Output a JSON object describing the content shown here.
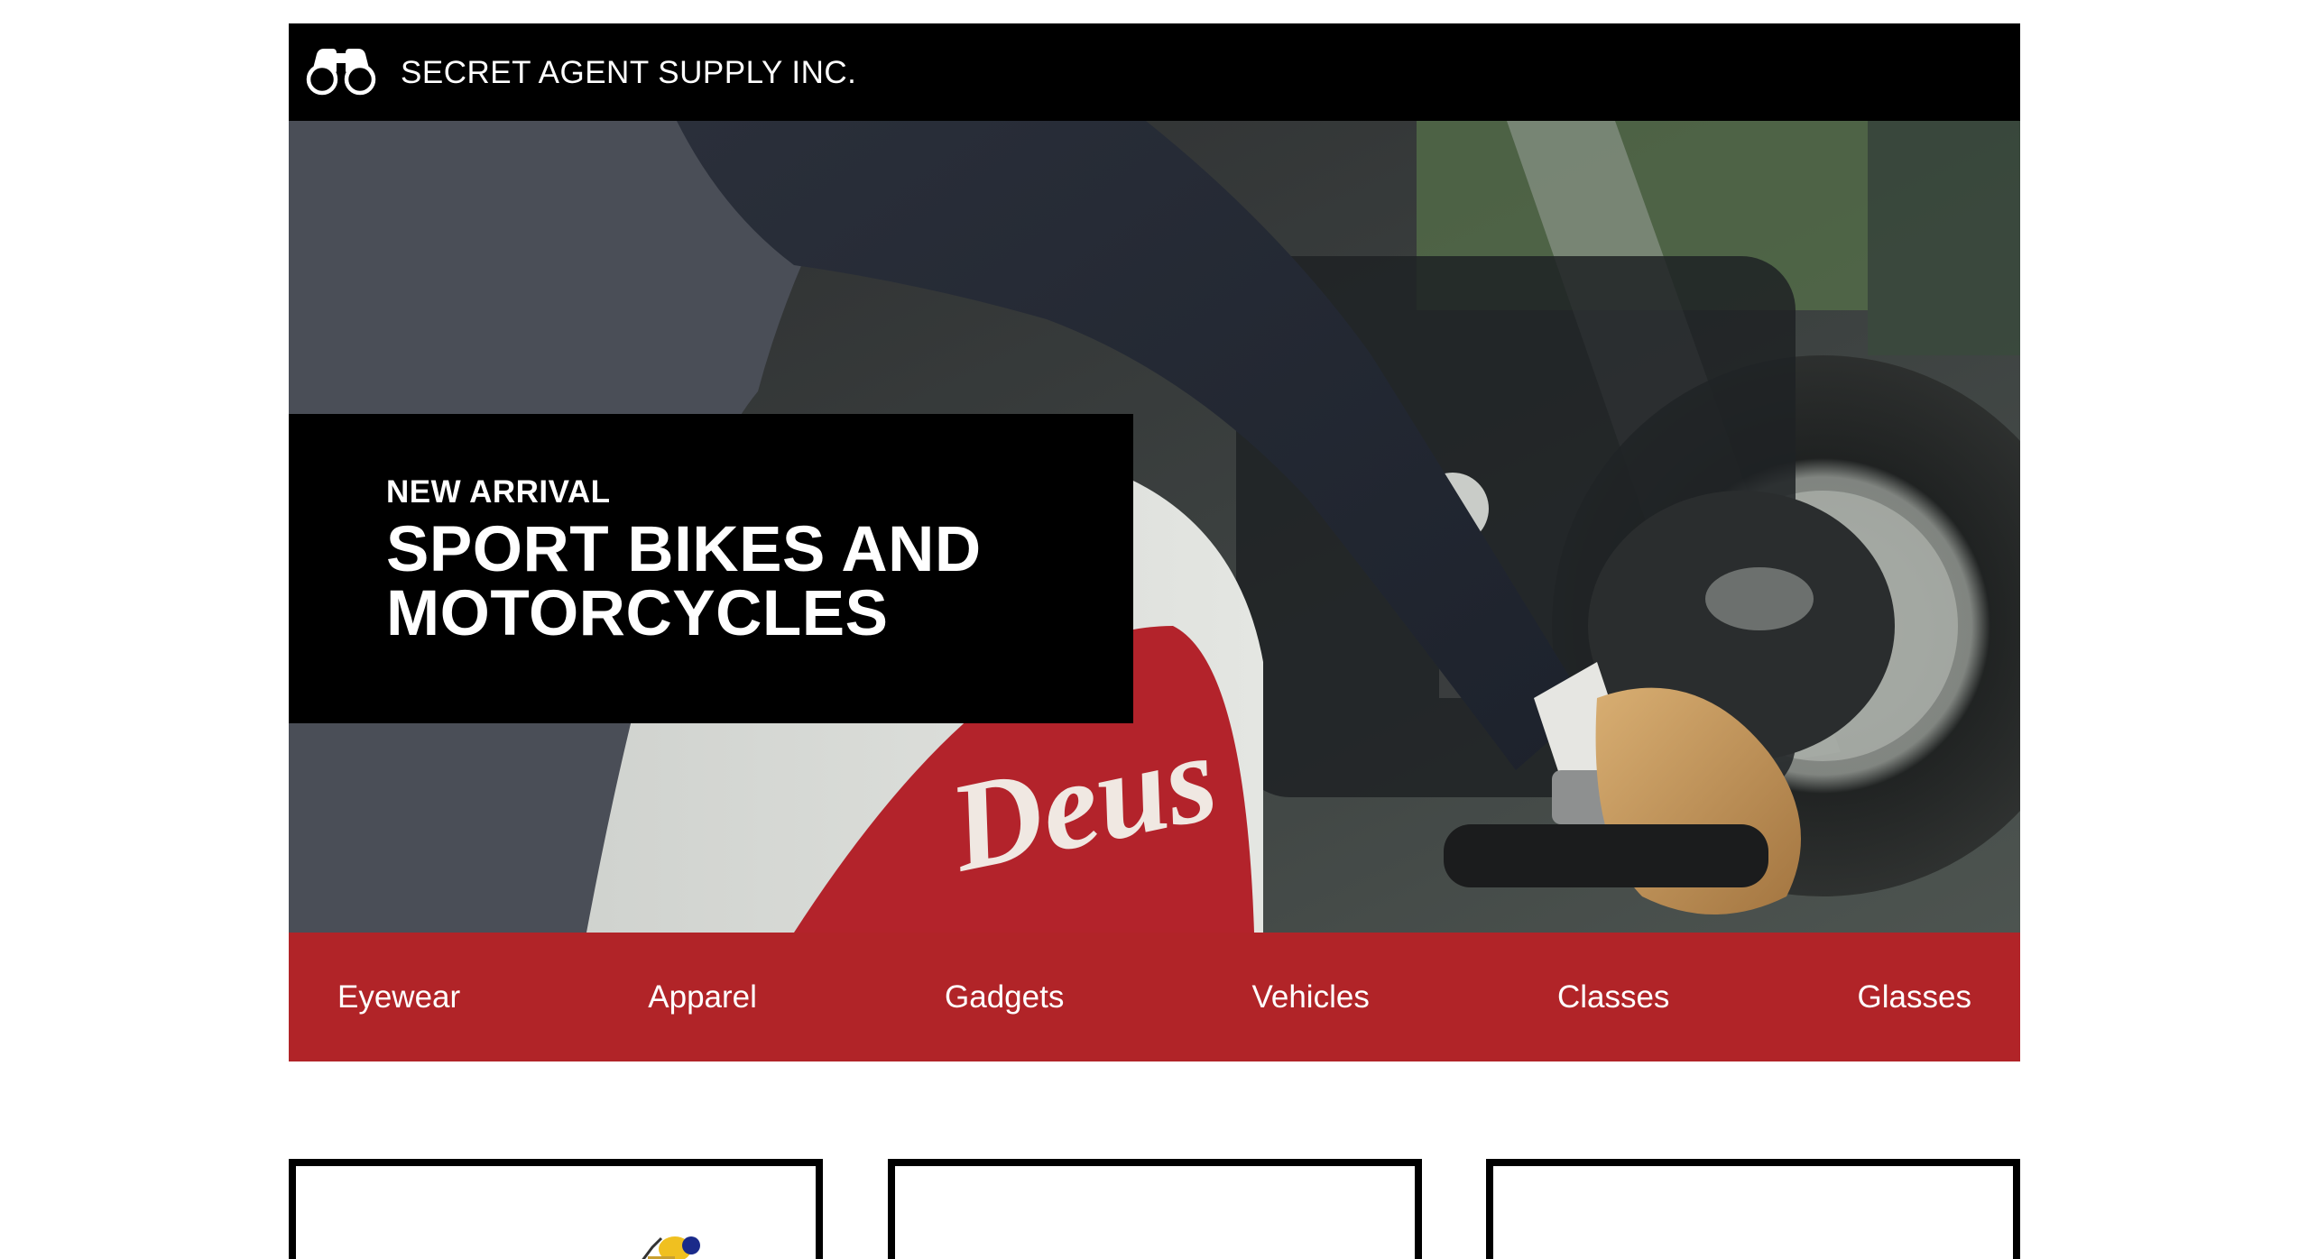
{
  "header": {
    "logo_icon": "binoculars-icon",
    "brand": "SECRET AGENT SUPPLY INC."
  },
  "hero": {
    "kicker": "NEW ARRIVAL",
    "title": "SPORT BIKES AND MOTORCYCLES",
    "image_text": "Deus"
  },
  "nav": {
    "items": [
      {
        "label": "Eyewear"
      },
      {
        "label": "Apparel"
      },
      {
        "label": "Gadgets"
      },
      {
        "label": "Vehicles"
      },
      {
        "label": "Classes"
      },
      {
        "label": "Glasses"
      }
    ]
  },
  "products": [
    {
      "image": "product-image"
    },
    {
      "image": "product-image"
    },
    {
      "image": "product-image"
    }
  ],
  "colors": {
    "header_bg": "#000000",
    "nav_bg": "#b12428",
    "text_on_dark": "#ffffff"
  }
}
